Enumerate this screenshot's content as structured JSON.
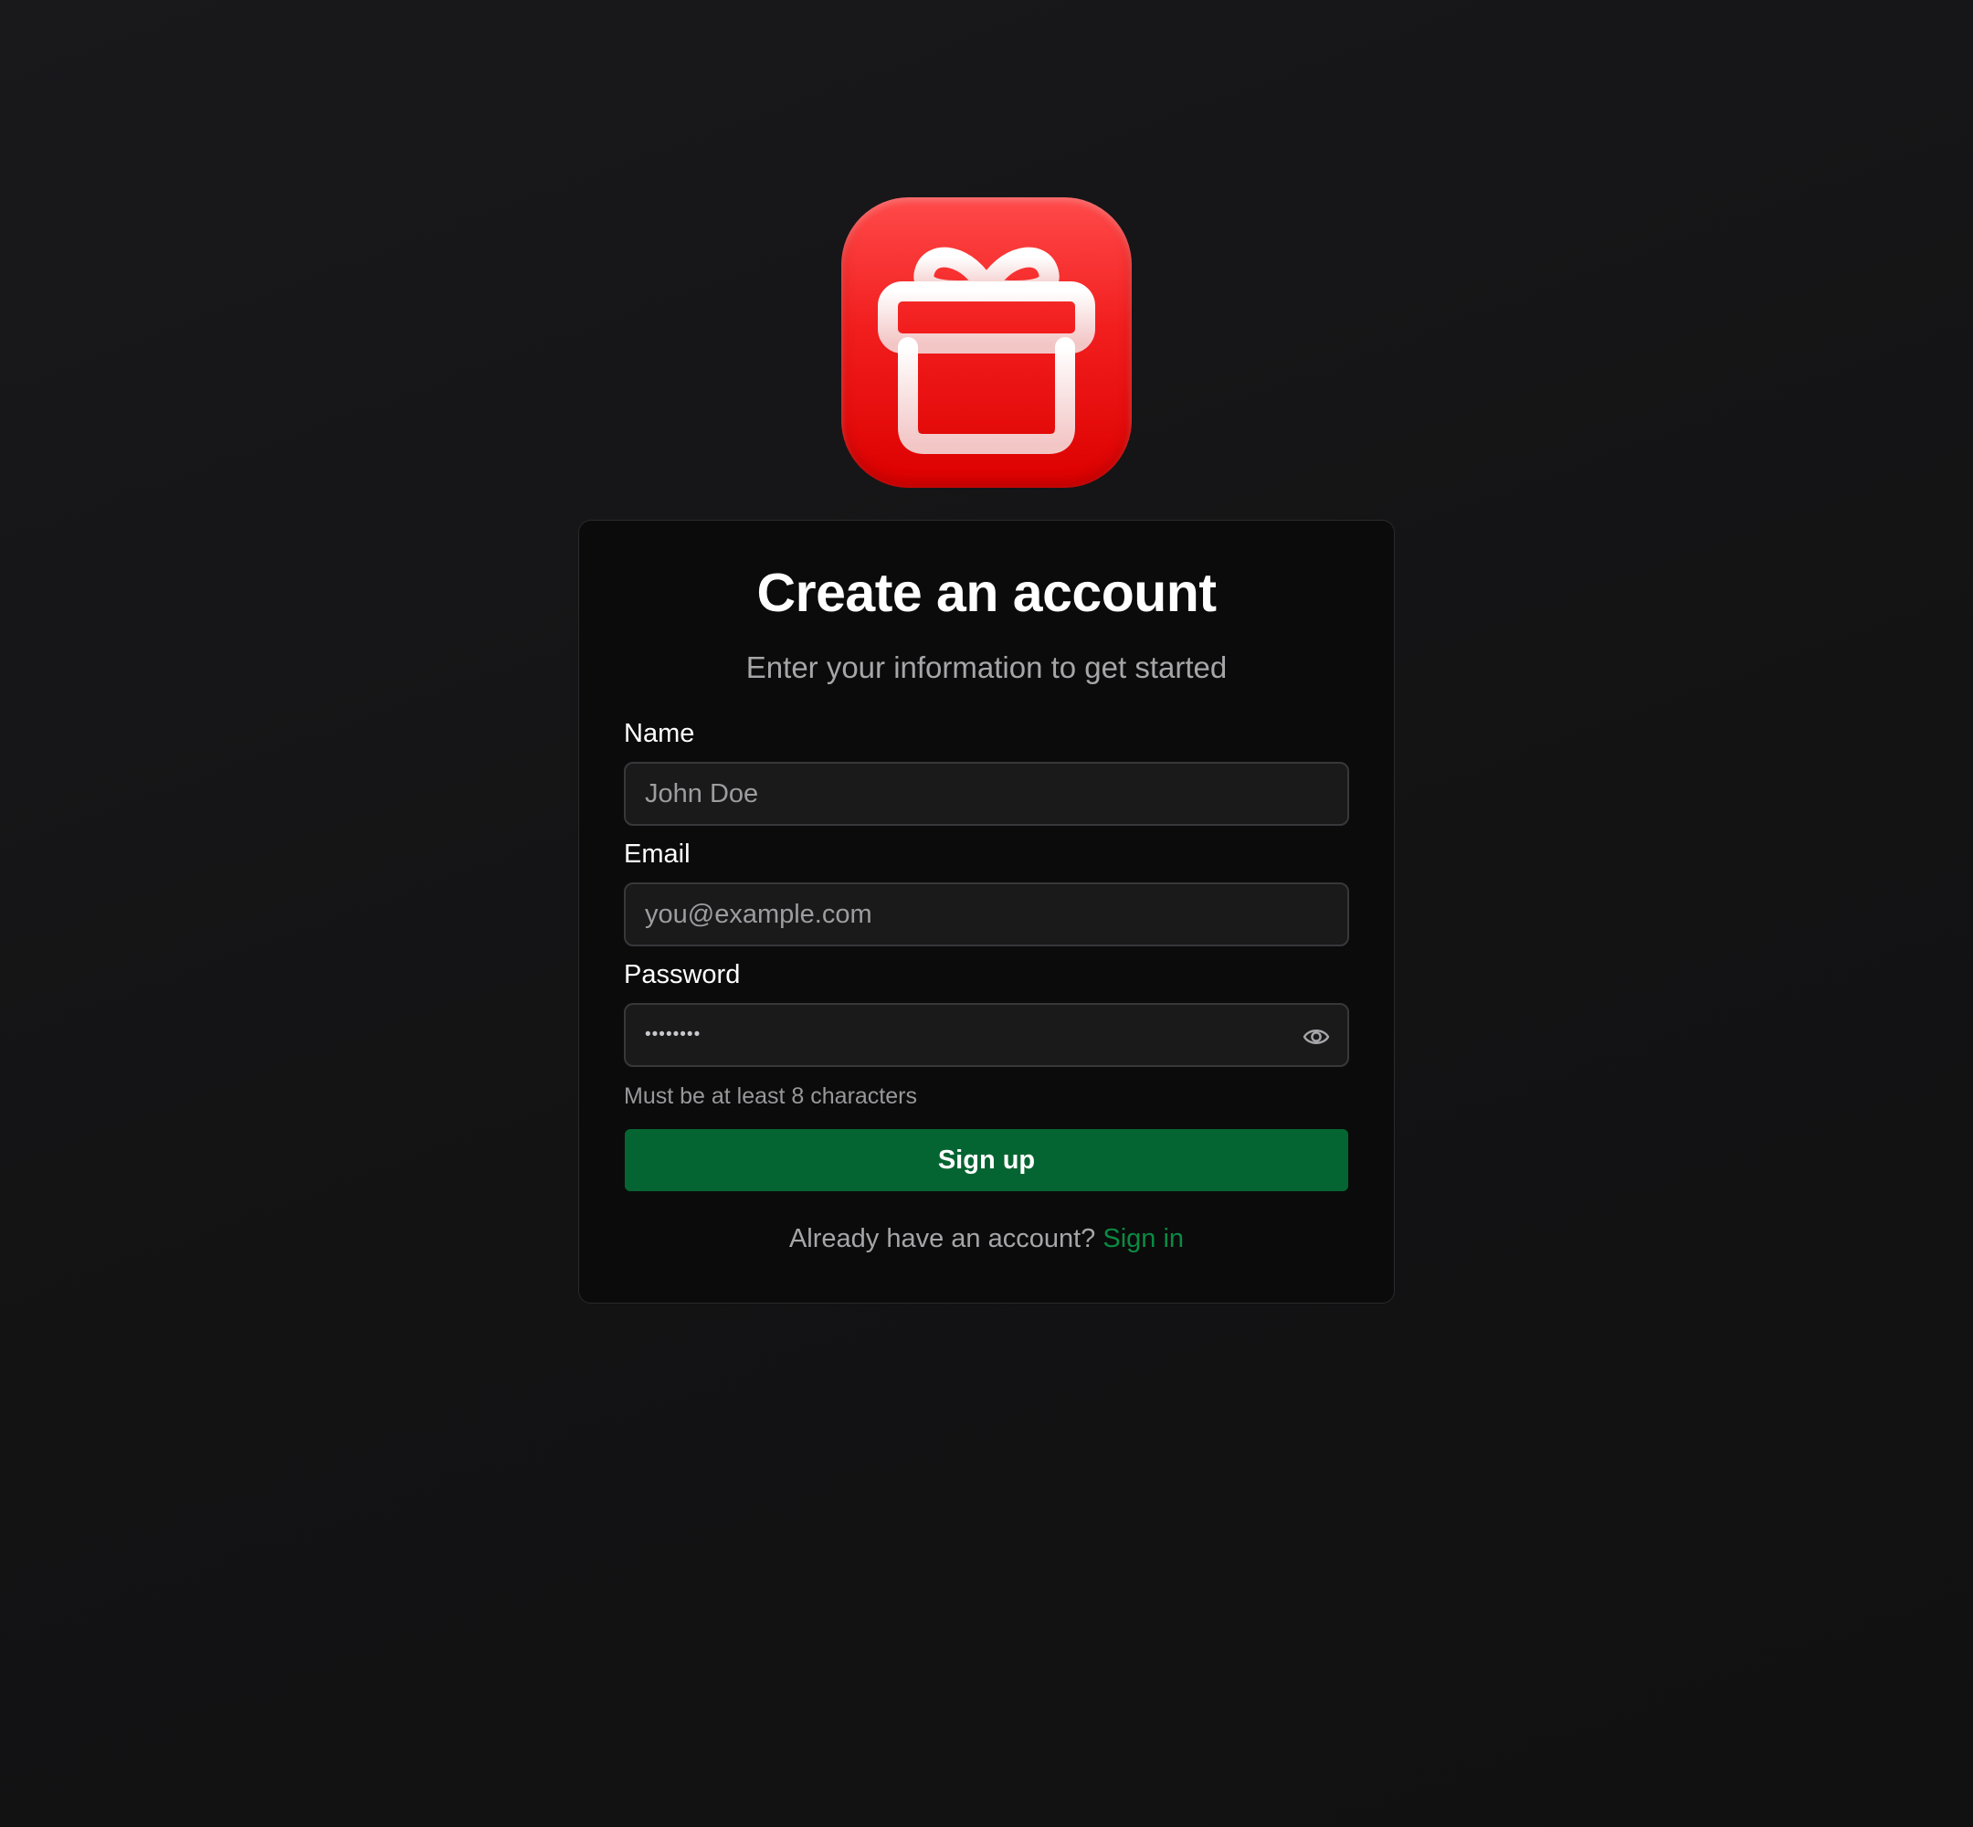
{
  "logo": {
    "icon": "gift-icon",
    "background_color": "#ee1111"
  },
  "header": {
    "title": "Create an account",
    "subtitle": "Enter your information to get started"
  },
  "form": {
    "name": {
      "label": "Name",
      "placeholder": "John Doe"
    },
    "email": {
      "label": "Email",
      "placeholder": "you@example.com"
    },
    "password": {
      "label": "Password",
      "masked_value": "••••••••",
      "toggle_icon": "eye-icon",
      "hint": "Must be at least 8 characters"
    },
    "submit_label": "Sign up"
  },
  "footer": {
    "prompt": "Already have an account?",
    "link_label": "Sign in"
  },
  "colors": {
    "accent_green": "#056532",
    "link_green": "#0a8a43",
    "page_background": "#151516",
    "card_background": "#0b0b0b"
  }
}
